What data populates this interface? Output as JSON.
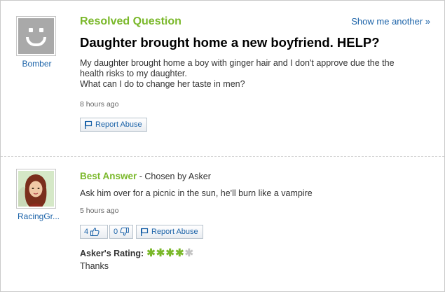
{
  "question": {
    "section_title": "Resolved Question",
    "show_another": "Show me another »",
    "asker_name": "Bomber",
    "title": "Daughter brought home a new boyfriend. HELP?",
    "body_line1": "My daughter brought home a boy with ginger hair and I don't approve due the the health risks to my daughter.",
    "body_line2": "What can I do to change her taste in men?",
    "timestamp": "8 hours ago",
    "report_label": "Report Abuse"
  },
  "answer": {
    "best_answer_label": "Best Answer",
    "chosen_by": " - Chosen by Asker",
    "answerer_name": "RacingGr...",
    "text": "Ask him over for a picnic in the sun, he'll burn like a vampire",
    "timestamp": "5 hours ago",
    "thumbs_up_count": "4",
    "thumbs_down_count": "0",
    "report_label": "Report Abuse",
    "rating_label": "Asker's Rating:",
    "rating_value": 4,
    "rating_max": 5,
    "rating_comment": "Thanks"
  },
  "colors": {
    "accent_green": "#7ab82a",
    "link_blue": "#1a62a8"
  },
  "icons": {
    "default_avatar": "smiley-avatar-icon",
    "flag": "flag-icon",
    "thumbs_up": "thumbs-up-icon",
    "thumbs_down": "thumbs-down-icon",
    "star": "star-icon"
  }
}
